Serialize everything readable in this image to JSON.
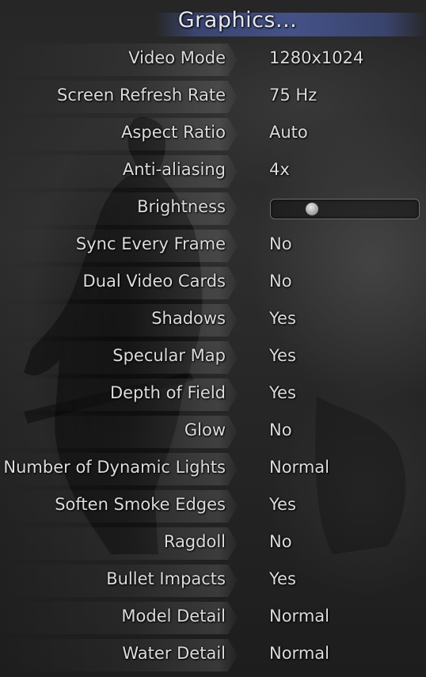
{
  "menu": {
    "title": "Graphics..."
  },
  "settings": [
    {
      "label": "Video Mode",
      "value": "1280x1024"
    },
    {
      "label": "Screen Refresh Rate",
      "value": "75 Hz"
    },
    {
      "label": "Aspect Ratio",
      "value": "Auto"
    },
    {
      "label": "Anti-aliasing",
      "value": "4x"
    },
    {
      "label": "Brightness",
      "value": null,
      "slider_level": 0.28
    },
    {
      "label": "Sync Every Frame",
      "value": "No"
    },
    {
      "label": "Dual Video Cards",
      "value": "No"
    },
    {
      "label": "Shadows",
      "value": "Yes"
    },
    {
      "label": "Specular Map",
      "value": "Yes"
    },
    {
      "label": "Depth of Field",
      "value": "Yes"
    },
    {
      "label": "Glow",
      "value": "No"
    },
    {
      "label": "Number of Dynamic Lights",
      "value": "Normal"
    },
    {
      "label": "Soften Smoke Edges",
      "value": "Yes"
    },
    {
      "label": "Ragdoll",
      "value": "No"
    },
    {
      "label": "Bullet Impacts",
      "value": "Yes"
    },
    {
      "label": "Model Detail",
      "value": "Normal"
    },
    {
      "label": "Water Detail",
      "value": "Normal"
    }
  ],
  "colors": {
    "title_accent": "#46548c",
    "text": "#dcdcdc",
    "background": "#262626"
  }
}
